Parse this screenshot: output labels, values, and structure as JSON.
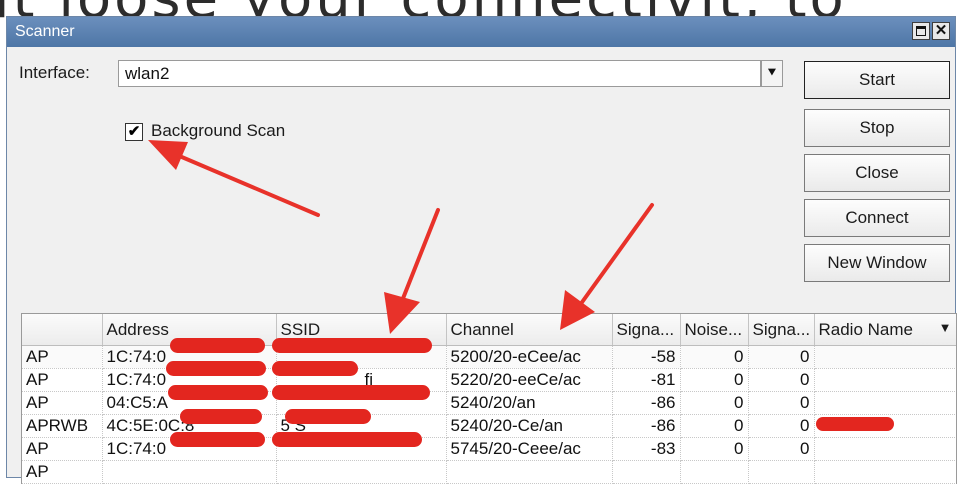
{
  "background_text": "it loose your connectivit, to",
  "window": {
    "title": "Scanner",
    "interface_label": "Interface:",
    "interface_value": "wlan2",
    "background_scan_label": "Background Scan",
    "background_scan_checked": true
  },
  "buttons": {
    "start": "Start",
    "stop": "Stop",
    "close": "Close",
    "connect": "Connect",
    "new_window": "New Window"
  },
  "table": {
    "columns": [
      "",
      "Address",
      "SSID",
      "Channel",
      "Signa...",
      "Noise...",
      "Signa...",
      "Radio Name"
    ],
    "rows": [
      {
        "type": "AP",
        "address": "1C:74:0",
        "ssid": "",
        "channel": "5200/20-eCee/ac",
        "signal": "-58",
        "noise": "0",
        "snr": "0",
        "radio_name": ""
      },
      {
        "type": "AP",
        "address": "1C:74:0",
        "ssid": "fi",
        "channel": "5220/20-eeCe/ac",
        "signal": "-81",
        "noise": "0",
        "snr": "0",
        "radio_name": ""
      },
      {
        "type": "AP",
        "address": "04:C5:A",
        "ssid": "",
        "channel": "5240/20/an",
        "signal": "-86",
        "noise": "0",
        "snr": "0",
        "radio_name": ""
      },
      {
        "type": "APRWB",
        "address": "4C:5E:0C:8",
        "ssid": "5 S",
        "channel": "5240/20-Ce/an",
        "signal": "-86",
        "noise": "0",
        "snr": "0",
        "radio_name": ""
      },
      {
        "type": "AP",
        "address": "1C:74:0",
        "ssid": "",
        "channel": "5745/20-Ceee/ac",
        "signal": "-83",
        "noise": "0",
        "snr": "0",
        "radio_name": ""
      },
      {
        "type": "AP",
        "address": "",
        "ssid": "",
        "channel": "",
        "signal": "",
        "noise": "",
        "snr": "",
        "radio_name": ""
      }
    ]
  },
  "colors": {
    "title_bar": "#5a7fb0",
    "annotation_arrow": "#e8322a",
    "redaction": "#e3261f"
  },
  "icons": {
    "maximize": "maximize-icon",
    "close": "close-icon",
    "dropdown": "dropdown-arrow-icon",
    "checkbox": "checkmark-icon",
    "column_menu": "sort-down-icon"
  }
}
